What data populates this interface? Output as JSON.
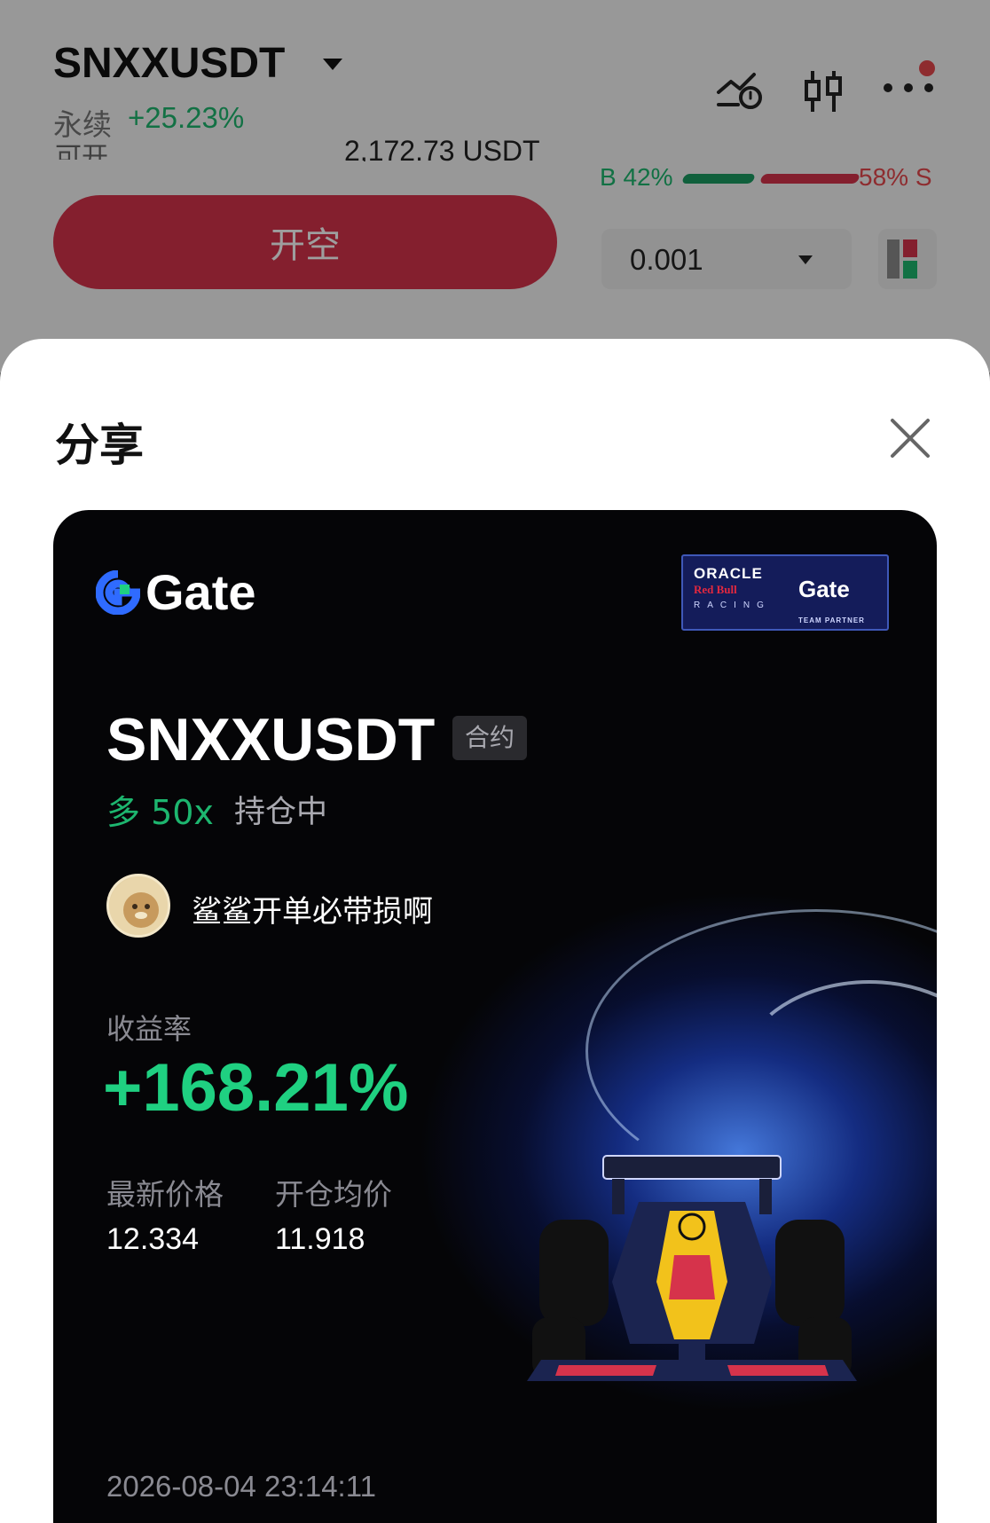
{
  "header": {
    "pair": "SNXXUSDT",
    "contract_type": "永续",
    "change": "+25.23%",
    "available_label": "可开",
    "available_value": "2,172.73 USDT",
    "buy_ratio": "B 42%",
    "sell_ratio": "58% S",
    "buy_ratio_value": 0.42,
    "sell_ratio_value": 0.58,
    "icons": [
      "price-alert-icon",
      "candlestick-icon",
      "more-icon"
    ]
  },
  "trade": {
    "short_button": "开空",
    "quantity": "0.001"
  },
  "share_sheet": {
    "title": "分享"
  },
  "card": {
    "brand": "Gate",
    "partner": {
      "line1": "ORACLE",
      "line2": "Red Bull",
      "line3": "RACING",
      "brand": "Gate",
      "tag": "TEAM PARTNER"
    },
    "pair": "SNXXUSDT",
    "tag": "合约",
    "direction": "多 50x",
    "status": "持仓中",
    "username": "鲨鲨开单必带损啊",
    "roi_label": "收益率",
    "roi": "+168.21%",
    "last_price_label": "最新价格",
    "last_price": "12.334",
    "open_price_label": "开仓均价",
    "open_price": "11.918",
    "timestamp": "2026-08-04 23:14:11"
  },
  "colors": {
    "green": "#1db66f",
    "red": "#d6334b",
    "card_bg": "#050507",
    "gate_blue": "#2f6bff"
  }
}
